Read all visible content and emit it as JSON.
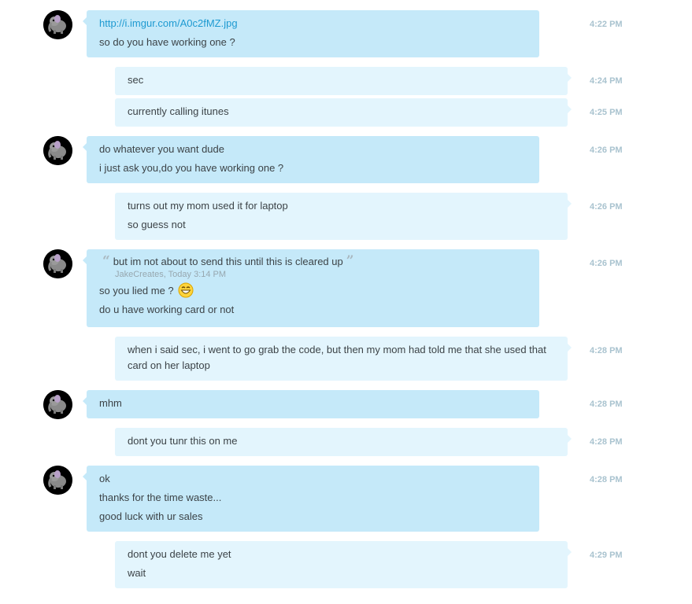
{
  "messages": [
    {
      "dir": "in",
      "lines": [
        "http://i.imgur.com/A0c2fMZ.jpg",
        "so do you have working one ?"
      ],
      "time": "4:22 PM"
    },
    {
      "dir": "out",
      "lines": [
        "sec"
      ],
      "time": "4:24 PM"
    },
    {
      "dir": "out",
      "lines": [
        "currently calling itunes"
      ],
      "time": "4:25 PM"
    },
    {
      "dir": "in",
      "lines": [
        "do whatever you want dude",
        "i just ask you,do you have working one ?"
      ],
      "time": "4:26 PM"
    },
    {
      "dir": "out",
      "lines": [
        "turns out my mom used it for laptop",
        "so guess not"
      ],
      "time": "4:26 PM"
    },
    {
      "dir": "in",
      "quote": {
        "text": "but im not about to send this until this is cleared up",
        "meta": "JakeCreates, Today 3:14 PM"
      },
      "lines": [
        "so you lied me ?",
        "do u have working card or not"
      ],
      "time": "4:26 PM"
    },
    {
      "dir": "out",
      "lines": [
        "when i said sec, i went to go grab the code, but then my mom had told me that she used that card on her laptop"
      ],
      "time": "4:28 PM"
    },
    {
      "dir": "in",
      "lines": [
        "mhm"
      ],
      "time": "4:28 PM"
    },
    {
      "dir": "out",
      "lines": [
        "dont you tunr this on me"
      ],
      "time": "4:28 PM"
    },
    {
      "dir": "in",
      "lines": [
        "ok",
        "thanks for the time waste...",
        "good luck with ur sales"
      ],
      "time": "4:28 PM"
    },
    {
      "dir": "out",
      "lines": [
        "dont you delete me yet",
        "wait"
      ],
      "time": "4:29 PM"
    }
  ],
  "colors": {
    "incoming_bubble": "#c5e9f9",
    "outgoing_bubble": "#e3f5fd",
    "timestamp": "#a9c3cf",
    "link": "#1e9ad1"
  },
  "icons": {
    "avatar": "elephant-avatar-icon",
    "emoticon": "laughing-emoticon-icon",
    "quote": "quote-marks-icon"
  }
}
